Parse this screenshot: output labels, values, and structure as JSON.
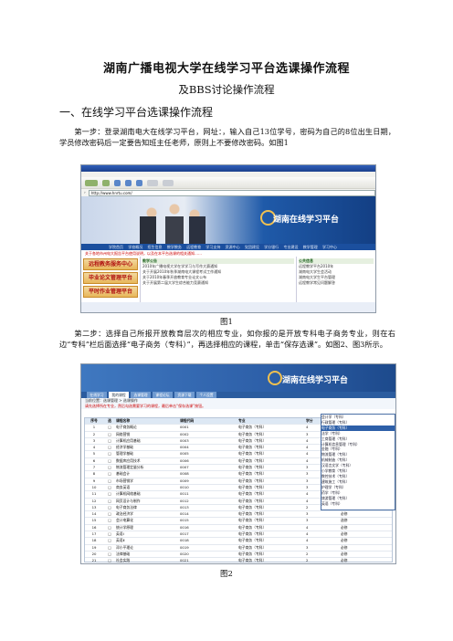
{
  "doc": {
    "title": "湖南广播电视大学在线学习平台选课操作流程",
    "subtitle": "及BBS讨论操作流程",
    "section1": "一、在线学习平台选课操作流程",
    "step1": "第一步：登录湖南电大在线学习平台，网址：，输入自己13位学号，密码为自己的8位出生日期，学员修改密码后一定要告知班主任老师，原则上不要修改密码。如图1",
    "fig1": "图1",
    "step2": "第二步：选择自己所报开放教育层次的相应专业，如你报的是开放专科电子商务专业，则在右边“专科”栏后面选择“电子商务（专科）”，再选择相应的课程，单击“保存选课”。如图2、图3所示。",
    "fig2": "图2"
  },
  "shot1": {
    "address": "http://www.hnrtu.com/",
    "logo": "湖南在线学习平台",
    "nav": "学院首页 学校概况 招生信息 教学教务 远程教育 学习支持 资源中心 党团建设 学分银行 专业建设 教学管理 学习中心",
    "notice": "关于各地市州电大报告平台使用说明，以及在本平台选课的相关通知……",
    "left_btns": [
      "远程教务服务中心",
      "毕业论文管理平台",
      "平时作业管理平台"
    ],
    "mid_header": "教学公告",
    "mid_items": [
      "2010年广播电视大学在学学习与写作大赛通知",
      "关于开展2010年秋季湖南电大课程考试工作通知",
      "关于2010年春季开放教育专业论文公布",
      "关于开展第二届大学生综合能力竞赛通知"
    ],
    "right_header": "公共信息",
    "right_items": [
      "远程教学平台2010年",
      "湖南电大学生会活动",
      "湖南电大学生平台管理",
      "远程教学常见问题解答"
    ]
  },
  "shot2": {
    "logo": "湖南在线学习平台",
    "tabs": [
      "在线学习",
      "我的课程",
      "选课管理",
      "课程论坛",
      "资源下载",
      "个人设置"
    ],
    "info": "当前位置：选课管理 > 选课操作",
    "instruction": "请先选择所在专业，然后勾选需要学习的课程，最后单击“保存选课”按钮。",
    "table_head": [
      "序号",
      "选",
      "课程名称",
      "课程代码",
      "专业",
      "学分",
      "状态"
    ],
    "rows": [
      [
        "1",
        "□",
        "电子商务概论",
        "0001",
        "电子商务（专科）",
        "4",
        "必修"
      ],
      [
        "2",
        "□",
        "网络营销",
        "0002",
        "电子商务（专科）",
        "3",
        "必修"
      ],
      [
        "3",
        "□",
        "计算机应用基础",
        "0003",
        "电子商务（专科）",
        "4",
        "必修"
      ],
      [
        "4",
        "□",
        "经济学基础",
        "0004",
        "电子商务（专科）",
        "4",
        "必修"
      ],
      [
        "5",
        "□",
        "管理学基础",
        "0005",
        "电子商务（专科）",
        "4",
        "必修"
      ],
      [
        "6",
        "□",
        "数据库应用技术",
        "0006",
        "电子商务（专科）",
        "4",
        "必修"
      ],
      [
        "7",
        "□",
        "物流管理定量分析",
        "0007",
        "电子商务（专科）",
        "3",
        "选修"
      ],
      [
        "8",
        "□",
        "基础会计",
        "0008",
        "电子商务（专科）",
        "3",
        "必修"
      ],
      [
        "9",
        "□",
        "市场营销学",
        "0009",
        "电子商务（专科）",
        "3",
        "选修"
      ],
      [
        "10",
        "□",
        "商务英语",
        "0010",
        "电子商务（专科）",
        "3",
        "选修"
      ],
      [
        "11",
        "□",
        "计算机网络基础",
        "0011",
        "电子商务（专科）",
        "4",
        "必修"
      ],
      [
        "12",
        "□",
        "网页设计与制作",
        "0012",
        "电子商务（专科）",
        "4",
        "必修"
      ],
      [
        "13",
        "□",
        "电子商务法律",
        "0013",
        "电子商务（专科）",
        "2",
        "选修"
      ],
      [
        "14",
        "□",
        "政治经济学",
        "0014",
        "电子商务（专科）",
        "3",
        "必修"
      ],
      [
        "15",
        "□",
        "会计电算化",
        "0015",
        "电子商务（专科）",
        "3",
        "选修"
      ],
      [
        "16",
        "□",
        "统计学原理",
        "0016",
        "电子商务（专科）",
        "4",
        "必修"
      ],
      [
        "17",
        "□",
        "英语Ⅰ",
        "0017",
        "电子商务（专科）",
        "4",
        "必修"
      ],
      [
        "18",
        "□",
        "英语Ⅱ",
        "0018",
        "电子商务（专科）",
        "4",
        "必修"
      ],
      [
        "19",
        "□",
        "邓小平理论",
        "0019",
        "电子商务（专科）",
        "3",
        "必修"
      ],
      [
        "20",
        "□",
        "法律基础",
        "0020",
        "电子商务（专科）",
        "2",
        "必修"
      ],
      [
        "21",
        "□",
        "社会实践",
        "0021",
        "电子商务（专科）",
        "2",
        "必修"
      ],
      [
        "22",
        "□",
        "毕业作业",
        "0022",
        "电子商务（专科）",
        "5",
        "必修"
      ]
    ],
    "dropdown": [
      "会计学（专科）",
      "行政管理（专科）",
      "电子商务（专科）",
      "法学（专科）",
      "工商管理（专科）",
      "计算机信息管理（专科）",
      "金融（专科）",
      "物流管理（专科）",
      "机械制造（专科）",
      "汉语言文学（专科）",
      "小学教育（专科）",
      "数控技术（专科）",
      "建筑施工（专科）",
      "护理学（专科）",
      "药学（专科）",
      "旅游管理（专科）",
      "英语（专科）"
    ]
  }
}
